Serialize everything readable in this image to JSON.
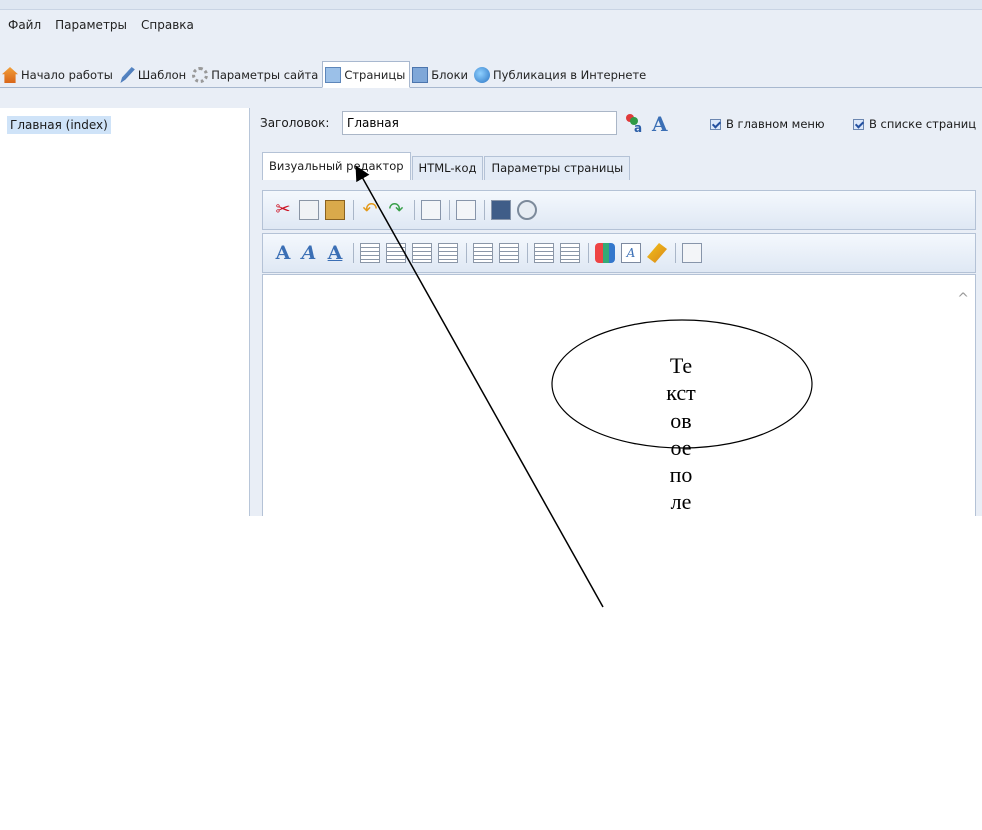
{
  "menu": [
    "Файл",
    "Параметры",
    "Справка"
  ],
  "main_tabs": [
    {
      "label": "Начало работы",
      "icon": "home-icon"
    },
    {
      "label": "Шаблон",
      "icon": "brush-icon"
    },
    {
      "label": "Параметры сайта",
      "icon": "gear-icon"
    },
    {
      "label": "Страницы",
      "icon": "pages-icon"
    },
    {
      "label": "Блоки",
      "icon": "blocks-icon"
    },
    {
      "label": "Публикация в Интернете",
      "icon": "globe-icon"
    }
  ],
  "sidebar": {
    "items": [
      "Главная (index)"
    ]
  },
  "page_form": {
    "title_label": "Заголовок:",
    "title_value": "Главная",
    "check_main_menu": "В главном меню",
    "check_page_list": "В списке страниц"
  },
  "editor_tabs": [
    "Визуальный редактор",
    "HTML-код",
    "Параметры страницы"
  ],
  "toolbar1_icons": [
    "cut-icon",
    "copy-icon",
    "paste-icon",
    "undo-icon",
    "redo-icon",
    "print-icon",
    "external-link-icon",
    "insert-image-icon",
    "insert-object-icon"
  ],
  "toolbar2_icons": [
    "font-icon",
    "italic-font-icon",
    "underline-font-icon",
    "align-left-icon",
    "align-center-icon",
    "align-right-icon",
    "align-justify-icon",
    "numbered-list-icon",
    "bullet-list-icon",
    "outdent-icon",
    "indent-icon",
    "text-color-icon",
    "text-style-icon",
    "clean-format-icon",
    "document-icon"
  ],
  "annotation": {
    "text": "Текстовое поле"
  }
}
